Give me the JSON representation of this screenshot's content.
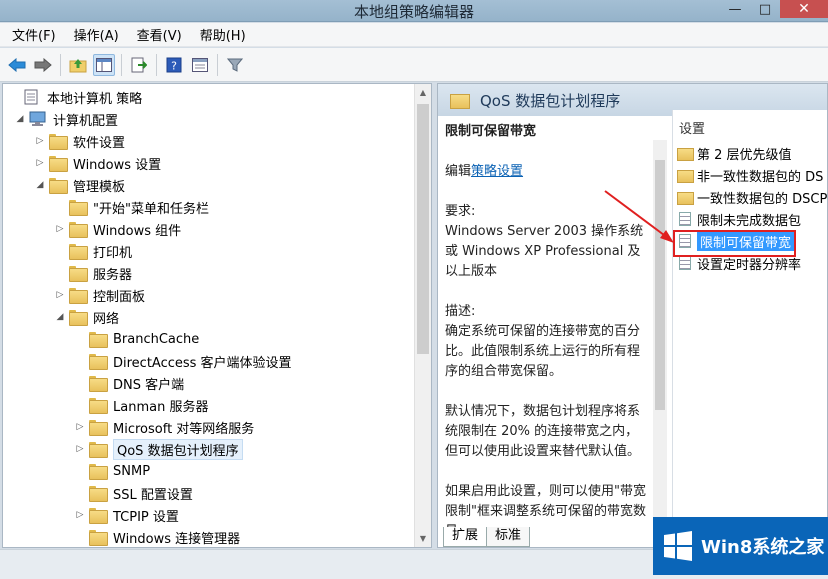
{
  "window": {
    "title": "本地组策略编辑器"
  },
  "menu": [
    "文件(F)",
    "操作(A)",
    "查看(V)",
    "帮助(H)"
  ],
  "toolbar": [
    "back-icon",
    "forward-icon",
    "up-folder-icon",
    "show-tree-icon",
    "export-icon",
    "help-icon",
    "properties-icon",
    "filter-icon"
  ],
  "tree": [
    {
      "label": "本地计算机 策略",
      "level": 0,
      "arrow": "",
      "icon": "policy"
    },
    {
      "label": "计算机配置",
      "level": 1,
      "arrow": "◢",
      "icon": "computer"
    },
    {
      "label": "软件设置",
      "level": 2,
      "arrow": "▷",
      "icon": "folder"
    },
    {
      "label": "Windows 设置",
      "level": 2,
      "arrow": "▷",
      "icon": "folder"
    },
    {
      "label": "管理模板",
      "level": 2,
      "arrow": "◢",
      "icon": "folder"
    },
    {
      "label": "\"开始\"菜单和任务栏",
      "level": 3,
      "arrow": "",
      "icon": "folder"
    },
    {
      "label": "Windows 组件",
      "level": 3,
      "arrow": "▷",
      "icon": "folder"
    },
    {
      "label": "打印机",
      "level": 3,
      "arrow": "",
      "icon": "folder"
    },
    {
      "label": "服务器",
      "level": 3,
      "arrow": "",
      "icon": "folder"
    },
    {
      "label": "控制面板",
      "level": 3,
      "arrow": "▷",
      "icon": "folder"
    },
    {
      "label": "网络",
      "level": 3,
      "arrow": "◢",
      "icon": "folder"
    },
    {
      "label": "BranchCache",
      "level": 4,
      "arrow": "",
      "icon": "folder"
    },
    {
      "label": "DirectAccess 客户端体验设置",
      "level": 4,
      "arrow": "",
      "icon": "folder"
    },
    {
      "label": "DNS 客户端",
      "level": 4,
      "arrow": "",
      "icon": "folder"
    },
    {
      "label": "Lanman 服务器",
      "level": 4,
      "arrow": "",
      "icon": "folder"
    },
    {
      "label": "Microsoft 对等网络服务",
      "level": 4,
      "arrow": "▷",
      "icon": "folder"
    },
    {
      "label": "QoS 数据包计划程序",
      "level": 4,
      "arrow": "▷",
      "icon": "folder",
      "selected": true
    },
    {
      "label": "SNMP",
      "level": 4,
      "arrow": "",
      "icon": "folder"
    },
    {
      "label": "SSL 配置设置",
      "level": 4,
      "arrow": "",
      "icon": "folder"
    },
    {
      "label": "TCPIP 设置",
      "level": 4,
      "arrow": "▷",
      "icon": "folder"
    },
    {
      "label": "Windows 连接管理器",
      "level": 4,
      "arrow": "",
      "icon": "folder"
    }
  ],
  "right": {
    "header": "QoS 数据包计划程序",
    "desc_title": "限制可保留带宽",
    "edit_prefix": "编辑",
    "edit_link": "策略设置",
    "req_label": "要求:",
    "req_text": "Windows Server 2003 操作系统或 Windows XP Professional 及以上版本",
    "desc_label": "描述:",
    "desc_p1": "确定系统可保留的连接带宽的百分比。此值限制系统上运行的所有程序的组合带宽保留。",
    "desc_p2": "默认情况下，数据包计划程序将系统限制在 20% 的连接带宽之内，但可以使用此设置来替代默认值。",
    "desc_p3": "如果启用此设置，则可以使用\"带宽限制\"框来调整系统可保留的带宽数量。",
    "tabs": [
      "扩展",
      "标准"
    ],
    "settings_header": "设置",
    "settings": [
      {
        "label": "第 2 层优先级值",
        "type": "folder"
      },
      {
        "label": "非一致性数据包的 DS",
        "type": "folder"
      },
      {
        "label": "一致性数据包的 DSCP",
        "type": "folder"
      },
      {
        "label": "限制未完成数据包",
        "type": "doc"
      },
      {
        "label": "限制可保留带宽",
        "type": "doc",
        "highlight": true
      },
      {
        "label": "设置定时器分辨率",
        "type": "doc"
      }
    ]
  },
  "watermark": {
    "text": "Win8系统之家"
  }
}
